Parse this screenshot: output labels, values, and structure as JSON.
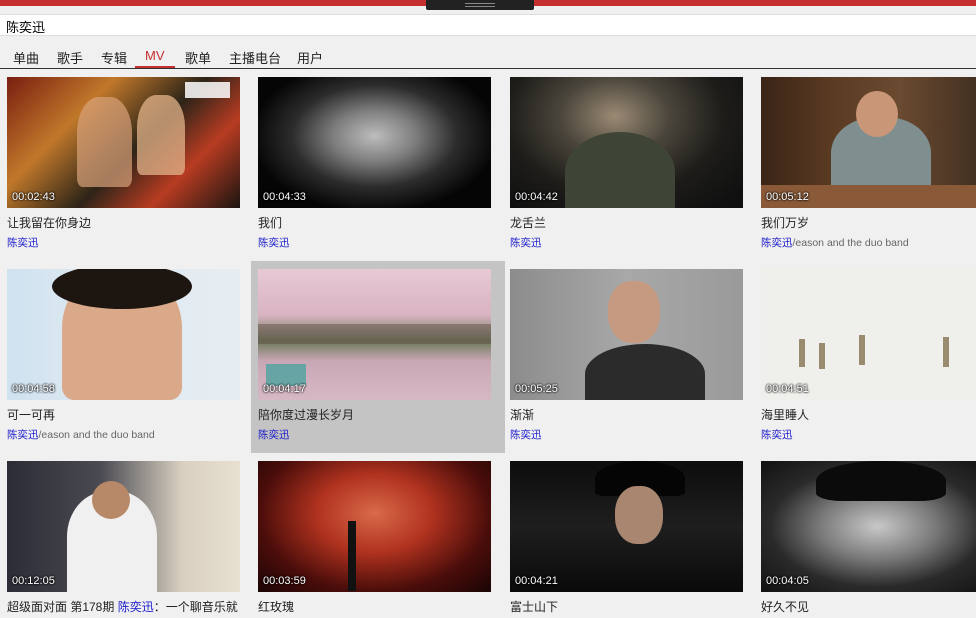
{
  "search": {
    "query": "陈奕迅"
  },
  "tabs": [
    {
      "label": "单曲",
      "active": false
    },
    {
      "label": "歌手",
      "active": false
    },
    {
      "label": "专辑",
      "active": false
    },
    {
      "label": "MV",
      "active": true
    },
    {
      "label": "歌单",
      "active": false
    },
    {
      "label": "主播电台",
      "active": false
    },
    {
      "label": "用户",
      "active": false
    }
  ],
  "mvs": [
    {
      "duration": "00:02:43",
      "title": "让我留在你身边",
      "artist": "陈奕迅",
      "extra": ""
    },
    {
      "duration": "00:04:33",
      "title": "我们",
      "artist": "陈奕迅",
      "extra": ""
    },
    {
      "duration": "00:04:42",
      "title": "龙舌兰",
      "artist": "陈奕迅",
      "extra": ""
    },
    {
      "duration": "00:05:12",
      "title": "我们万岁",
      "artist": "陈奕迅",
      "extra": "/eason and the duo band"
    },
    {
      "duration": "00:04:58",
      "title": "可一可再",
      "artist": "陈奕迅",
      "extra": "/eason and the duo band"
    },
    {
      "duration": "00:04:17",
      "title": "陪你度过漫长岁月",
      "artist": "陈奕迅",
      "extra": ""
    },
    {
      "duration": "00:05:25",
      "title": "渐渐",
      "artist": "陈奕迅",
      "extra": ""
    },
    {
      "duration": "00:04:51",
      "title": "海里睡人",
      "artist": "陈奕迅",
      "extra": ""
    },
    {
      "duration": "00:12:05",
      "title": "超级面对面 第178期 ",
      "title_name": "陈奕迅",
      "title_rest": "：一个聊音乐就",
      "artist": "",
      "extra": ""
    },
    {
      "duration": "00:03:59",
      "title": "红玫瑰",
      "artist": "",
      "extra": ""
    },
    {
      "duration": "00:04:21",
      "title": "富士山下",
      "artist": "",
      "extra": ""
    },
    {
      "duration": "00:04:05",
      "title": "好久不见",
      "artist": "",
      "extra": ""
    }
  ],
  "colors": {
    "accent": "#c62f2f",
    "link": "#1a1acc"
  }
}
